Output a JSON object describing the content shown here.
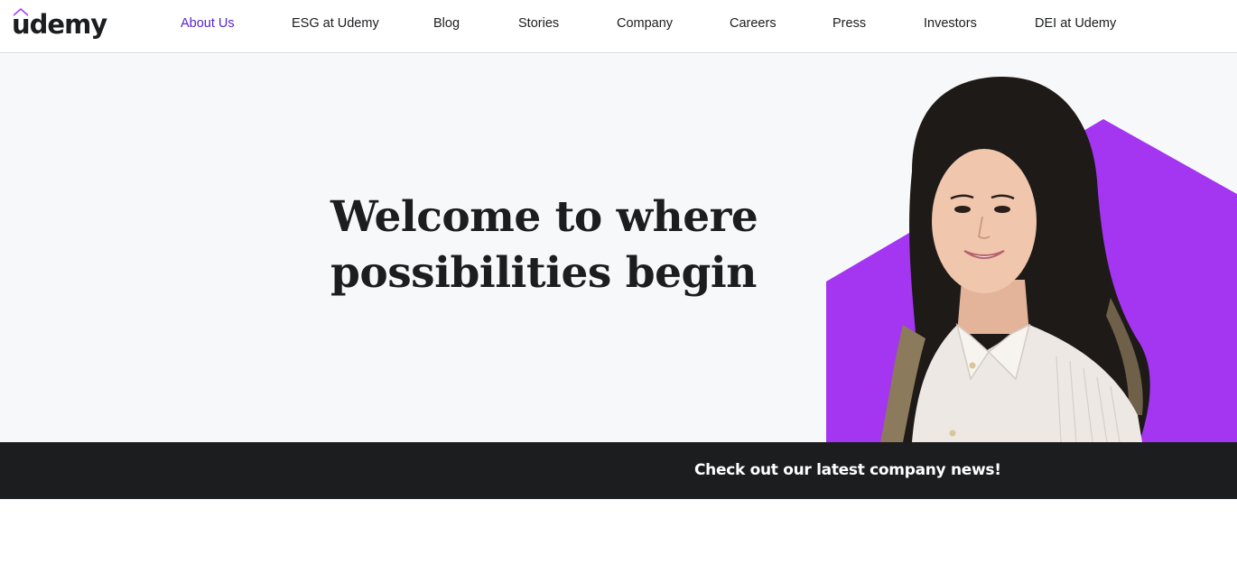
{
  "brand": {
    "name": "udemy",
    "accent_color": "#a435f0",
    "link_color": "#5624d0"
  },
  "nav": {
    "items": [
      {
        "label": "About Us",
        "active": true
      },
      {
        "label": "ESG at Udemy",
        "active": false
      },
      {
        "label": "Blog",
        "active": false
      },
      {
        "label": "Stories",
        "active": false
      },
      {
        "label": "Company",
        "active": false
      },
      {
        "label": "Careers",
        "active": false
      },
      {
        "label": "Press",
        "active": false
      },
      {
        "label": "Investors",
        "active": false
      },
      {
        "label": "DEI at Udemy",
        "active": false
      }
    ]
  },
  "hero": {
    "heading_line1": "Welcome to where",
    "heading_line2": "possibilities begin",
    "background_color": "#f7f8fa",
    "image_description_icon": "hero-portrait-image"
  },
  "news_bar": {
    "text": "Check out our latest company news!",
    "background_color": "#1c1d1f"
  }
}
